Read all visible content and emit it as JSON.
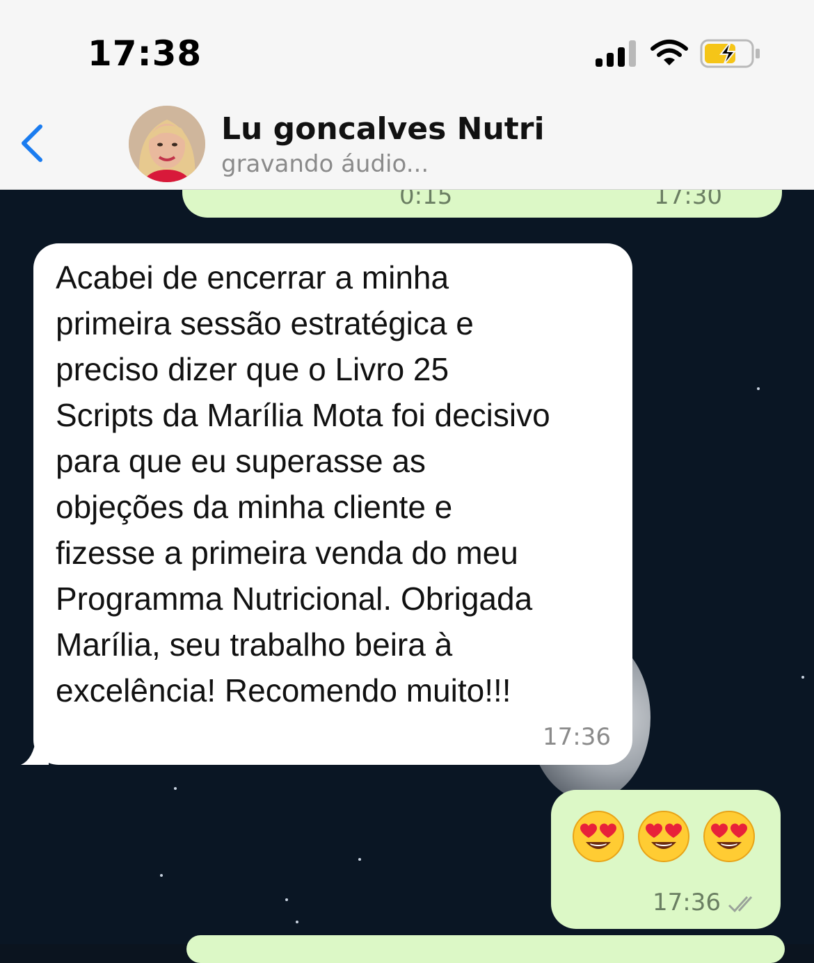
{
  "status_bar": {
    "time": "17:38",
    "icons": [
      "cellular-signal-icon",
      "wifi-icon",
      "battery-charging-icon"
    ]
  },
  "header": {
    "back_icon": "chevron-left-icon",
    "contact_name": "Lu goncalves Nutri",
    "contact_status": "gravando áudio...",
    "accent_color": "#1a7cf0"
  },
  "messages": {
    "previous_audio": {
      "duration": "0:15",
      "time": "17:30"
    },
    "received": {
      "text": "Acabei de encerrar a minha\nprimeira sessão estratégica e\npreciso dizer que o Livro 25\nScripts da Marília Mota foi decisivo\npara que eu superasse as\nobjeções da minha cliente e\nfizesse a primeira venda do meu\nProgramma Nutricional. Obrigada\nMarília, seu trabalho beira à\nexcelência! Recomendo muito!!!",
      "time": "17:36"
    },
    "sent_emoji": {
      "emojis": [
        "smiling-face-with-heart-eyes-icon",
        "smiling-face-with-heart-eyes-icon",
        "smiling-face-with-heart-eyes-icon"
      ],
      "time": "17:36"
    }
  },
  "colors": {
    "outgoing_bubble": "#dcf8c6",
    "incoming_bubble": "#ffffff",
    "chat_background": "#0a1624"
  }
}
